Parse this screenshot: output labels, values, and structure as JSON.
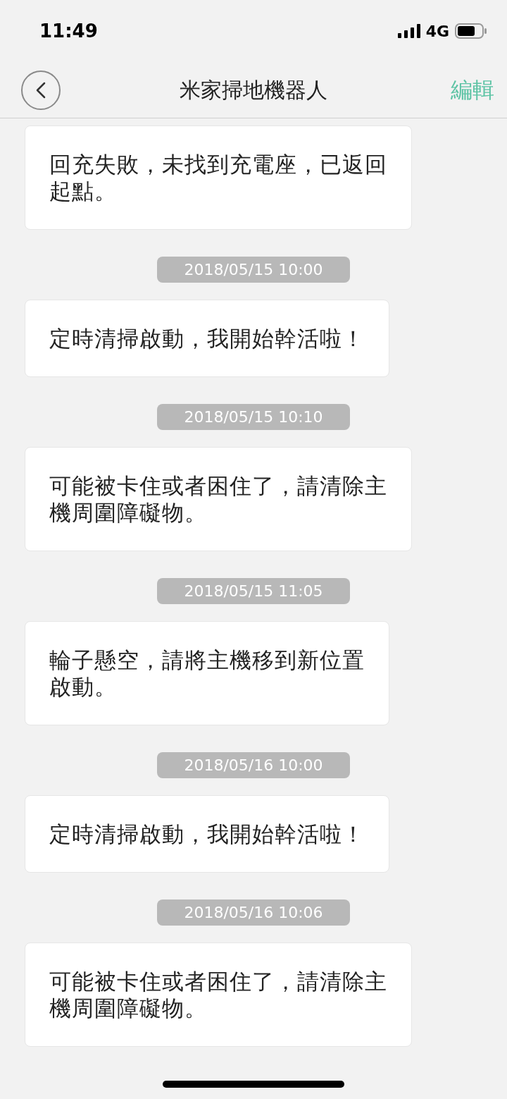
{
  "status_bar": {
    "time": "11:49",
    "network": "4G"
  },
  "nav": {
    "title": "米家掃地機器人",
    "action": "編輯"
  },
  "messages": [
    {
      "kind": "card",
      "lines": [
        "回充失敗，未找到充電座，已返回",
        "起點。"
      ]
    },
    {
      "kind": "time",
      "text": "2018/05/15 10:00"
    },
    {
      "kind": "card",
      "lines": [
        "定時清掃啟動，我開始幹活啦！"
      ]
    },
    {
      "kind": "time",
      "text": "2018/05/15 10:10"
    },
    {
      "kind": "card",
      "lines": [
        "可能被卡住或者困住了，請清除主",
        "機周圍障礙物。"
      ]
    },
    {
      "kind": "time",
      "text": "2018/05/15 11:05"
    },
    {
      "kind": "card",
      "lines": [
        "輪子懸空，請將主機移到新位置",
        "啟動。"
      ]
    },
    {
      "kind": "time",
      "text": "2018/05/16 10:00"
    },
    {
      "kind": "card",
      "lines": [
        "定時清掃啟動，我開始幹活啦！"
      ]
    },
    {
      "kind": "time",
      "text": "2018/05/16 10:06"
    },
    {
      "kind": "card",
      "lines": [
        "可能被卡住或者困住了，請清除主",
        "機周圍障礙物。"
      ]
    }
  ]
}
